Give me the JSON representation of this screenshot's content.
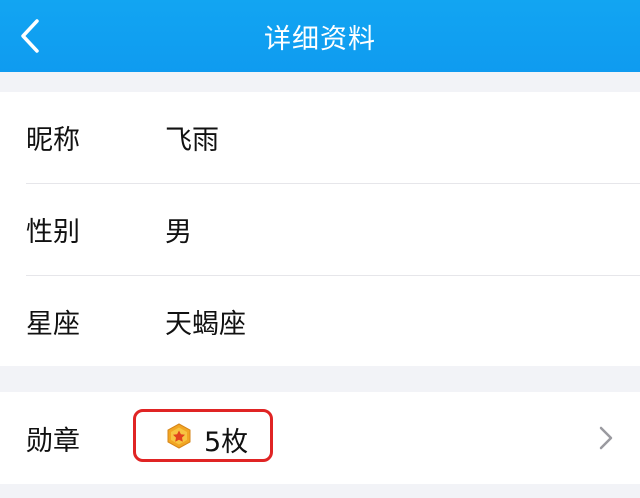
{
  "header": {
    "title": "详细资料",
    "back_icon": "chevron-left-icon",
    "background": "#0f9bf0"
  },
  "profile": {
    "rows": [
      {
        "label": "昵称",
        "value": "飞雨"
      },
      {
        "label": "性别",
        "value": "男"
      },
      {
        "label": "星座",
        "value": "天蝎座"
      }
    ]
  },
  "badges": {
    "label": "勋章",
    "count_text": "5枚",
    "icon": "star-badge-icon",
    "chevron_icon": "chevron-right-icon",
    "highlight_color": "#e02424"
  }
}
